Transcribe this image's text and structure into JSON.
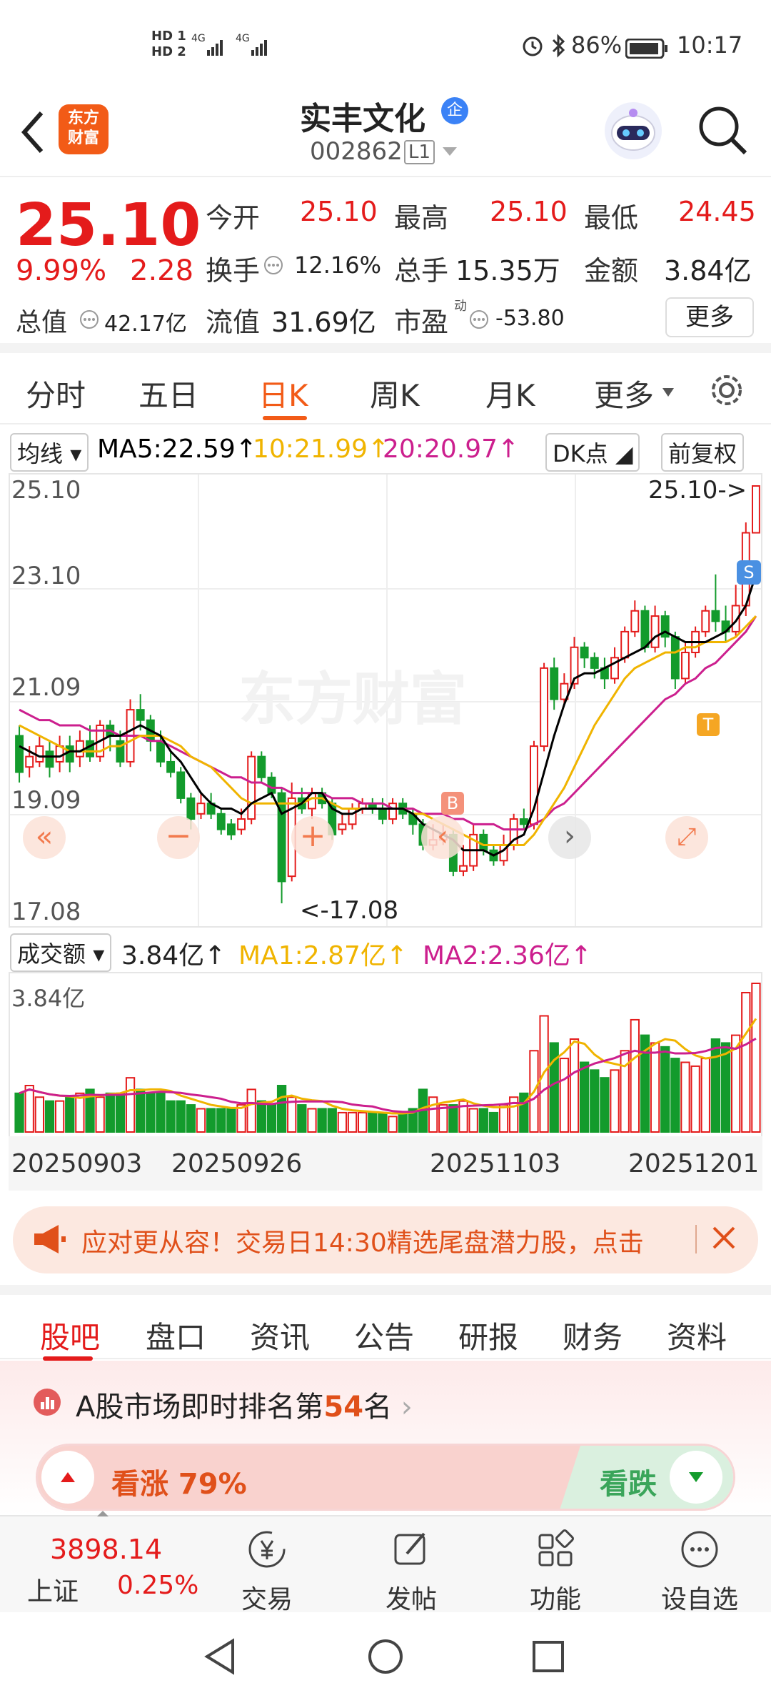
{
  "status": {
    "sim1": "HD 1",
    "sim2": "HD 2",
    "net": "4G",
    "battery": "86%",
    "time": "10:17"
  },
  "header": {
    "logo_line1": "东方",
    "logo_line2": "财富",
    "stock_name": "实丰文化",
    "badge": "企",
    "stock_code": "002862",
    "level": "L1"
  },
  "quote": {
    "price": "25.10",
    "pct": "9.99%",
    "change": "2.28",
    "open_label": "今开",
    "open": "25.10",
    "high_label": "最高",
    "high": "25.10",
    "low_label": "最低",
    "low": "24.45",
    "turnover_label": "换手",
    "turnover": "12.16%",
    "volume_label": "总手",
    "volume": "15.35万",
    "amount_label": "金额",
    "amount": "3.84亿",
    "mktcap_label": "总值",
    "mktcap": "42.17亿",
    "float_label": "流值",
    "float": "31.69亿",
    "pe_label": "市盈",
    "pe_sup": "动",
    "pe": "-53.80",
    "more": "更多"
  },
  "tabs": [
    "分时",
    "五日",
    "日K",
    "周K",
    "月K",
    "更多"
  ],
  "indicators": {
    "ma_select": "均线",
    "ma5": "MA5:22.59↑",
    "ma10": "10:21.99↑",
    "ma20": "20:20.97↑",
    "dk": "DK点",
    "adjust": "前复权"
  },
  "chart_axis": {
    "y1": "25.10",
    "y2": "23.10",
    "y3": "21.09",
    "y4": "19.09",
    "y5": "17.08",
    "max_label": "25.10->",
    "min_label": "<-17.08",
    "watermark": "东方财富",
    "b_mark": "B",
    "s_mark": "S",
    "t_mark": "T"
  },
  "vol_row": {
    "select": "成交额",
    "value": "3.84亿↑",
    "ma1": "MA1:2.87亿↑",
    "ma2": "MA2:2.36亿↑",
    "axis_top": "3.84亿"
  },
  "dates": [
    "20250903",
    "20250926",
    "20251103",
    "20251201"
  ],
  "banner": {
    "text": "应对更从容！交易日14:30精选尾盘潜力股，点击"
  },
  "sectabs": [
    "股吧",
    "盘口",
    "资讯",
    "公告",
    "研报",
    "财务",
    "资料"
  ],
  "rank": {
    "prefix": "A股市场即时排名第",
    "num": "54",
    "suffix": "名",
    "up": "看涨 79%",
    "down": "看跌"
  },
  "bottomnav": {
    "index": "3898.14",
    "index_name": "上证",
    "index_pct": "0.25%",
    "trade": "交易",
    "post": "发帖",
    "func": "功能",
    "watch": "设自选"
  },
  "colors": {
    "up": "#e41b1b",
    "down": "#139b2c",
    "ma5": "#000000",
    "ma10": "#f0b400",
    "ma20": "#cc1f8e"
  },
  "chart_data": {
    "type": "candlestick",
    "ylim": [
      17.08,
      25.1
    ],
    "candles": [
      [
        20.3,
        19.6,
        20.5,
        19.4
      ],
      [
        19.7,
        19.9,
        20.1,
        19.5
      ],
      [
        19.8,
        20.1,
        20.3,
        19.7
      ],
      [
        20.0,
        19.7,
        20.2,
        19.5
      ],
      [
        19.8,
        20.1,
        20.3,
        19.6
      ],
      [
        20.1,
        19.8,
        20.3,
        19.6
      ],
      [
        19.9,
        20.2,
        20.4,
        19.7
      ],
      [
        20.2,
        19.9,
        20.5,
        19.8
      ],
      [
        19.9,
        20.5,
        20.6,
        19.8
      ],
      [
        20.5,
        20.3,
        20.6,
        20.0
      ],
      [
        20.2,
        19.8,
        20.4,
        19.7
      ],
      [
        19.8,
        20.8,
        21.0,
        19.7
      ],
      [
        20.8,
        20.6,
        21.1,
        20.4
      ],
      [
        20.6,
        20.2,
        20.7,
        20.0
      ],
      [
        20.2,
        19.8,
        20.4,
        19.7
      ],
      [
        19.8,
        19.6,
        20.0,
        19.5
      ],
      [
        19.6,
        19.1,
        19.7,
        19.0
      ],
      [
        19.1,
        18.7,
        19.2,
        18.5
      ],
      [
        18.8,
        19.0,
        19.2,
        18.7
      ],
      [
        19.0,
        18.8,
        19.2,
        18.7
      ],
      [
        18.8,
        18.5,
        18.9,
        18.4
      ],
      [
        18.6,
        18.4,
        18.7,
        18.3
      ],
      [
        18.5,
        18.7,
        18.9,
        18.4
      ],
      [
        18.7,
        19.9,
        20.0,
        18.6
      ],
      [
        19.9,
        19.5,
        20.0,
        19.4
      ],
      [
        19.5,
        19.2,
        19.6,
        19.1
      ],
      [
        19.2,
        17.5,
        19.3,
        17.08
      ],
      [
        17.6,
        19.1,
        19.4,
        17.5
      ],
      [
        19.1,
        18.9,
        19.3,
        18.8
      ],
      [
        18.9,
        19.2,
        19.3,
        18.7
      ],
      [
        19.2,
        19.0,
        19.3,
        18.9
      ],
      [
        19.0,
        18.4,
        19.1,
        18.3
      ],
      [
        18.5,
        18.6,
        18.8,
        18.4
      ],
      [
        18.6,
        18.9,
        19.0,
        18.5
      ],
      [
        18.9,
        19.0,
        19.1,
        18.8
      ],
      [
        19.0,
        18.9,
        19.1,
        18.8
      ],
      [
        18.9,
        18.7,
        19.1,
        18.6
      ],
      [
        18.7,
        19.0,
        19.1,
        18.6
      ],
      [
        19.0,
        18.8,
        19.1,
        18.7
      ],
      [
        18.8,
        18.6,
        18.9,
        18.4
      ],
      [
        18.6,
        18.2,
        18.7,
        18.1
      ],
      [
        18.2,
        18.3,
        18.6,
        18.1
      ],
      [
        18.3,
        18.4,
        18.6,
        18.2
      ],
      [
        18.4,
        17.7,
        18.5,
        17.6
      ],
      [
        17.7,
        17.8,
        18.2,
        17.6
      ],
      [
        17.8,
        18.4,
        18.6,
        17.7
      ],
      [
        18.4,
        18.1,
        18.5,
        18.0
      ],
      [
        18.1,
        17.9,
        18.2,
        17.8
      ],
      [
        17.9,
        18.2,
        18.4,
        17.8
      ],
      [
        18.2,
        18.7,
        18.8,
        18.1
      ],
      [
        18.7,
        18.6,
        18.9,
        18.5
      ],
      [
        18.6,
        20.1,
        20.2,
        18.5
      ],
      [
        20.1,
        21.6,
        21.7,
        20.0
      ],
      [
        21.6,
        21.0,
        21.8,
        20.8
      ],
      [
        21.0,
        21.3,
        21.5,
        20.9
      ],
      [
        21.3,
        22.0,
        22.2,
        21.2
      ],
      [
        22.0,
        21.8,
        22.1,
        21.6
      ],
      [
        21.8,
        21.6,
        21.9,
        21.4
      ],
      [
        21.6,
        21.4,
        21.8,
        21.2
      ],
      [
        21.4,
        21.8,
        22.0,
        21.3
      ],
      [
        21.8,
        22.3,
        22.4,
        21.7
      ],
      [
        22.3,
        22.7,
        22.9,
        22.2
      ],
      [
        22.7,
        22.0,
        22.8,
        21.9
      ],
      [
        22.0,
        22.6,
        22.8,
        21.9
      ],
      [
        22.6,
        22.2,
        22.7,
        22.0
      ],
      [
        22.2,
        21.4,
        22.3,
        21.2
      ],
      [
        21.4,
        21.9,
        22.1,
        21.3
      ],
      [
        21.9,
        22.3,
        22.4,
        21.8
      ],
      [
        22.3,
        22.7,
        22.8,
        22.2
      ],
      [
        22.7,
        22.5,
        23.4,
        22.3
      ],
      [
        22.5,
        22.3,
        22.8,
        22.1
      ],
      [
        22.3,
        22.8,
        23.2,
        22.2
      ],
      [
        22.8,
        24.2,
        24.4,
        22.6
      ],
      [
        24.2,
        25.1,
        25.1,
        24.45
      ]
    ],
    "ma5": [
      20.1,
      20.0,
      19.9,
      19.9,
      19.9,
      20.0,
      20.0,
      20.1,
      20.2,
      20.3,
      20.3,
      20.4,
      20.5,
      20.4,
      20.3,
      20.0,
      19.8,
      19.5,
      19.2,
      19.0,
      18.9,
      18.9,
      18.8,
      19.0,
      19.1,
      19.2,
      18.8,
      18.9,
      19.0,
      19.2,
      19.2,
      18.9,
      18.8,
      18.8,
      18.9,
      18.9,
      18.9,
      18.9,
      18.9,
      18.8,
      18.6,
      18.5,
      18.4,
      18.3,
      18.1,
      18.1,
      18.1,
      18.0,
      18.1,
      18.3,
      18.4,
      18.9,
      19.6,
      20.3,
      20.9,
      21.4,
      21.5,
      21.5,
      21.6,
      21.7,
      21.8,
      21.9,
      22.0,
      22.2,
      22.3,
      22.2,
      22.1,
      22.1,
      22.1,
      22.2,
      22.3,
      22.5,
      22.8,
      23.4
    ],
    "ma10": [
      20.5,
      20.4,
      20.3,
      20.2,
      20.1,
      20.0,
      20.0,
      20.0,
      20.0,
      20.1,
      20.1,
      20.2,
      20.3,
      20.3,
      20.3,
      20.2,
      20.1,
      19.9,
      19.8,
      19.7,
      19.5,
      19.3,
      19.1,
      19.0,
      19.0,
      19.0,
      19.0,
      19.0,
      19.0,
      19.1,
      19.1,
      19.0,
      18.9,
      18.9,
      18.9,
      18.9,
      18.9,
      18.9,
      18.9,
      18.8,
      18.8,
      18.7,
      18.6,
      18.5,
      18.4,
      18.3,
      18.2,
      18.2,
      18.2,
      18.2,
      18.2,
      18.4,
      18.7,
      19.0,
      19.3,
      19.7,
      20.1,
      20.5,
      20.8,
      21.1,
      21.4,
      21.6,
      21.7,
      21.8,
      21.9,
      21.9,
      22.0,
      22.0,
      22.1,
      22.1,
      22.1,
      22.2,
      22.4,
      22.6
    ],
    "ma20": [
      20.8,
      20.7,
      20.6,
      20.6,
      20.5,
      20.5,
      20.5,
      20.4,
      20.4,
      20.4,
      20.3,
      20.3,
      20.3,
      20.2,
      20.2,
      20.1,
      20.0,
      19.9,
      19.8,
      19.7,
      19.6,
      19.5,
      19.5,
      19.4,
      19.4,
      19.3,
      19.3,
      19.2,
      19.2,
      19.2,
      19.2,
      19.1,
      19.1,
      19.1,
      19.0,
      19.0,
      19.0,
      18.9,
      18.9,
      18.9,
      18.8,
      18.8,
      18.8,
      18.7,
      18.7,
      18.6,
      18.6,
      18.6,
      18.5,
      18.5,
      18.5,
      18.6,
      18.7,
      18.9,
      19.0,
      19.2,
      19.4,
      19.6,
      19.8,
      20.0,
      20.2,
      20.4,
      20.6,
      20.8,
      21.0,
      21.1,
      21.3,
      21.4,
      21.6,
      21.7,
      21.9,
      22.1,
      22.3,
      22.6
    ],
    "volume": [
      1.0,
      1.2,
      0.9,
      0.8,
      0.8,
      0.9,
      1.0,
      1.1,
      0.9,
      1.0,
      1.0,
      1.4,
      1.1,
      1.0,
      1.0,
      0.8,
      0.8,
      0.7,
      0.6,
      0.6,
      0.6,
      0.6,
      0.7,
      1.1,
      0.8,
      0.7,
      1.2,
      0.9,
      0.7,
      0.6,
      0.6,
      0.6,
      0.5,
      0.5,
      0.5,
      0.5,
      0.5,
      0.4,
      0.5,
      0.6,
      1.1,
      0.9,
      0.7,
      0.7,
      0.8,
      0.6,
      0.6,
      0.5,
      0.7,
      0.9,
      1.0,
      2.1,
      3.0,
      2.3,
      1.9,
      2.4,
      1.8,
      1.6,
      1.4,
      1.6,
      2.1,
      2.9,
      2.5,
      2.3,
      2.2,
      1.9,
      1.8,
      1.7,
      1.9,
      2.4,
      2.3,
      2.5,
      3.6,
      3.84
    ]
  }
}
